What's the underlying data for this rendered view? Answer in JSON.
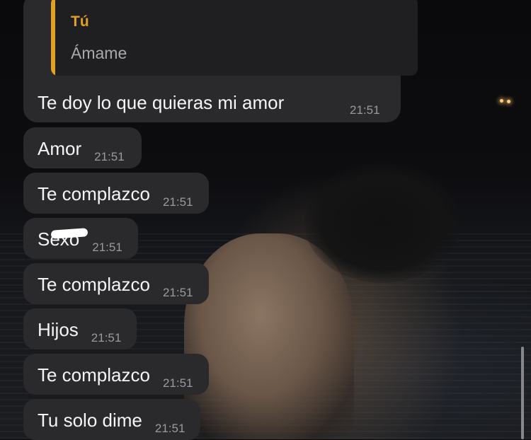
{
  "reply": {
    "quote_author": "Tú",
    "quote_text": "Ámame",
    "text": "Te doy lo que quieras mi amor",
    "time": "21:51"
  },
  "messages": [
    {
      "text": "Amor",
      "time": "21:51"
    },
    {
      "text": "Te complazco",
      "time": "21:51"
    },
    {
      "text": "Sexo",
      "time": "21:51"
    },
    {
      "text": "Te complazco",
      "time": "21:51"
    },
    {
      "text": "Hijos",
      "time": "21:51"
    },
    {
      "text": "Te complazco",
      "time": "21:51"
    },
    {
      "text": "Tu solo dime",
      "time": "21:51"
    }
  ],
  "colors": {
    "bubble": "#2a2a2d",
    "quote_accent": "#e0a126",
    "timestamp": "#9a9a9e"
  }
}
